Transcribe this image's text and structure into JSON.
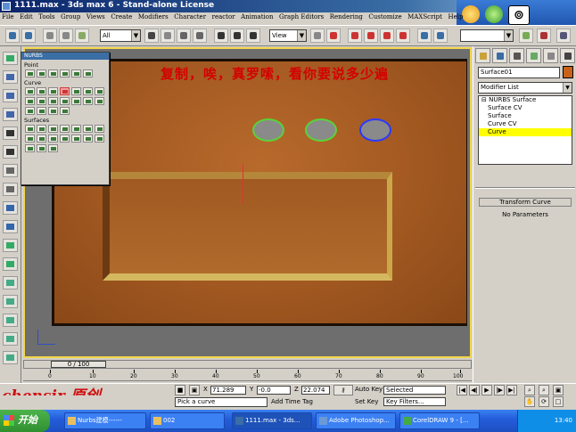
{
  "window": {
    "title": "1111.max  -  3ds max 6  -  Stand-alone License"
  },
  "menu": [
    "File",
    "Edit",
    "Tools",
    "Group",
    "Views",
    "Create",
    "Modifiers",
    "Character",
    "reactor",
    "Animation",
    "Graph Editors",
    "Rendering",
    "Customize",
    "MAXScript",
    "Help"
  ],
  "toolbar": {
    "selection_filter": "All",
    "ref_coord": "View"
  },
  "viewport": {
    "annotation": "复制，唉，真罗嗦，看你要说多少遍"
  },
  "nurbs_panel": {
    "title": "NURBS",
    "sections": [
      "Point",
      "Curve",
      "Surfaces"
    ]
  },
  "command_panel": {
    "object_name": "Surface01",
    "modifier_list_label": "Modifier List",
    "stack": [
      {
        "label": "NURBS Surface",
        "selected": false
      },
      {
        "label": "Surface CV",
        "selected": false
      },
      {
        "label": "Surface",
        "selected": false
      },
      {
        "label": "Curve CV",
        "selected": false
      },
      {
        "label": "Curve",
        "selected": true
      }
    ],
    "rollout_title": "Transform Curve",
    "rollout_text": "No Parameters"
  },
  "timeline": {
    "slider_label": "0 / 100",
    "ticks": [
      "0",
      "10",
      "20",
      "30",
      "40",
      "50",
      "60",
      "70",
      "80",
      "90",
      "100"
    ]
  },
  "status": {
    "brand": "chensir 原创",
    "x_label": "X",
    "x_value": "71.289",
    "y_label": "Y",
    "y_value": "-0.0",
    "z_label": "Z",
    "z_value": "22.074",
    "auto_key": "Auto Key",
    "selected": "Selected",
    "set_key": "Set Key",
    "key_filters": "Key Filters...",
    "prompt": "Pick a curve",
    "add_time_tag": "Add Time Tag"
  },
  "taskbar": {
    "start_label": "开始",
    "tasks": [
      {
        "label": "Nurbs建模------",
        "active": false
      },
      {
        "label": "002",
        "active": false
      },
      {
        "label": "1111.max - 3ds...",
        "active": true
      },
      {
        "label": "Adobe Photoshop...",
        "active": false
      },
      {
        "label": "CorelDRAW 9 - [...",
        "active": false
      }
    ],
    "clock": "13:40"
  }
}
